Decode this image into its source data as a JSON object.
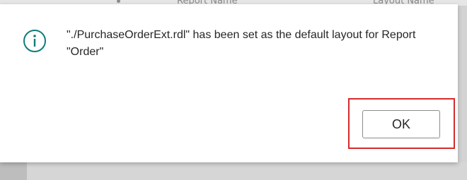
{
  "background": {
    "columns": [
      "Report Name",
      "Layout Name"
    ]
  },
  "dialog": {
    "icon": "info-icon",
    "message": "\"./PurchaseOrderExt.rdl\" has been set as the default layout for Report \"Order\"",
    "ok_label": "OK"
  },
  "colors": {
    "accent": "#0f7c7a",
    "highlight": "#d32b2b"
  }
}
